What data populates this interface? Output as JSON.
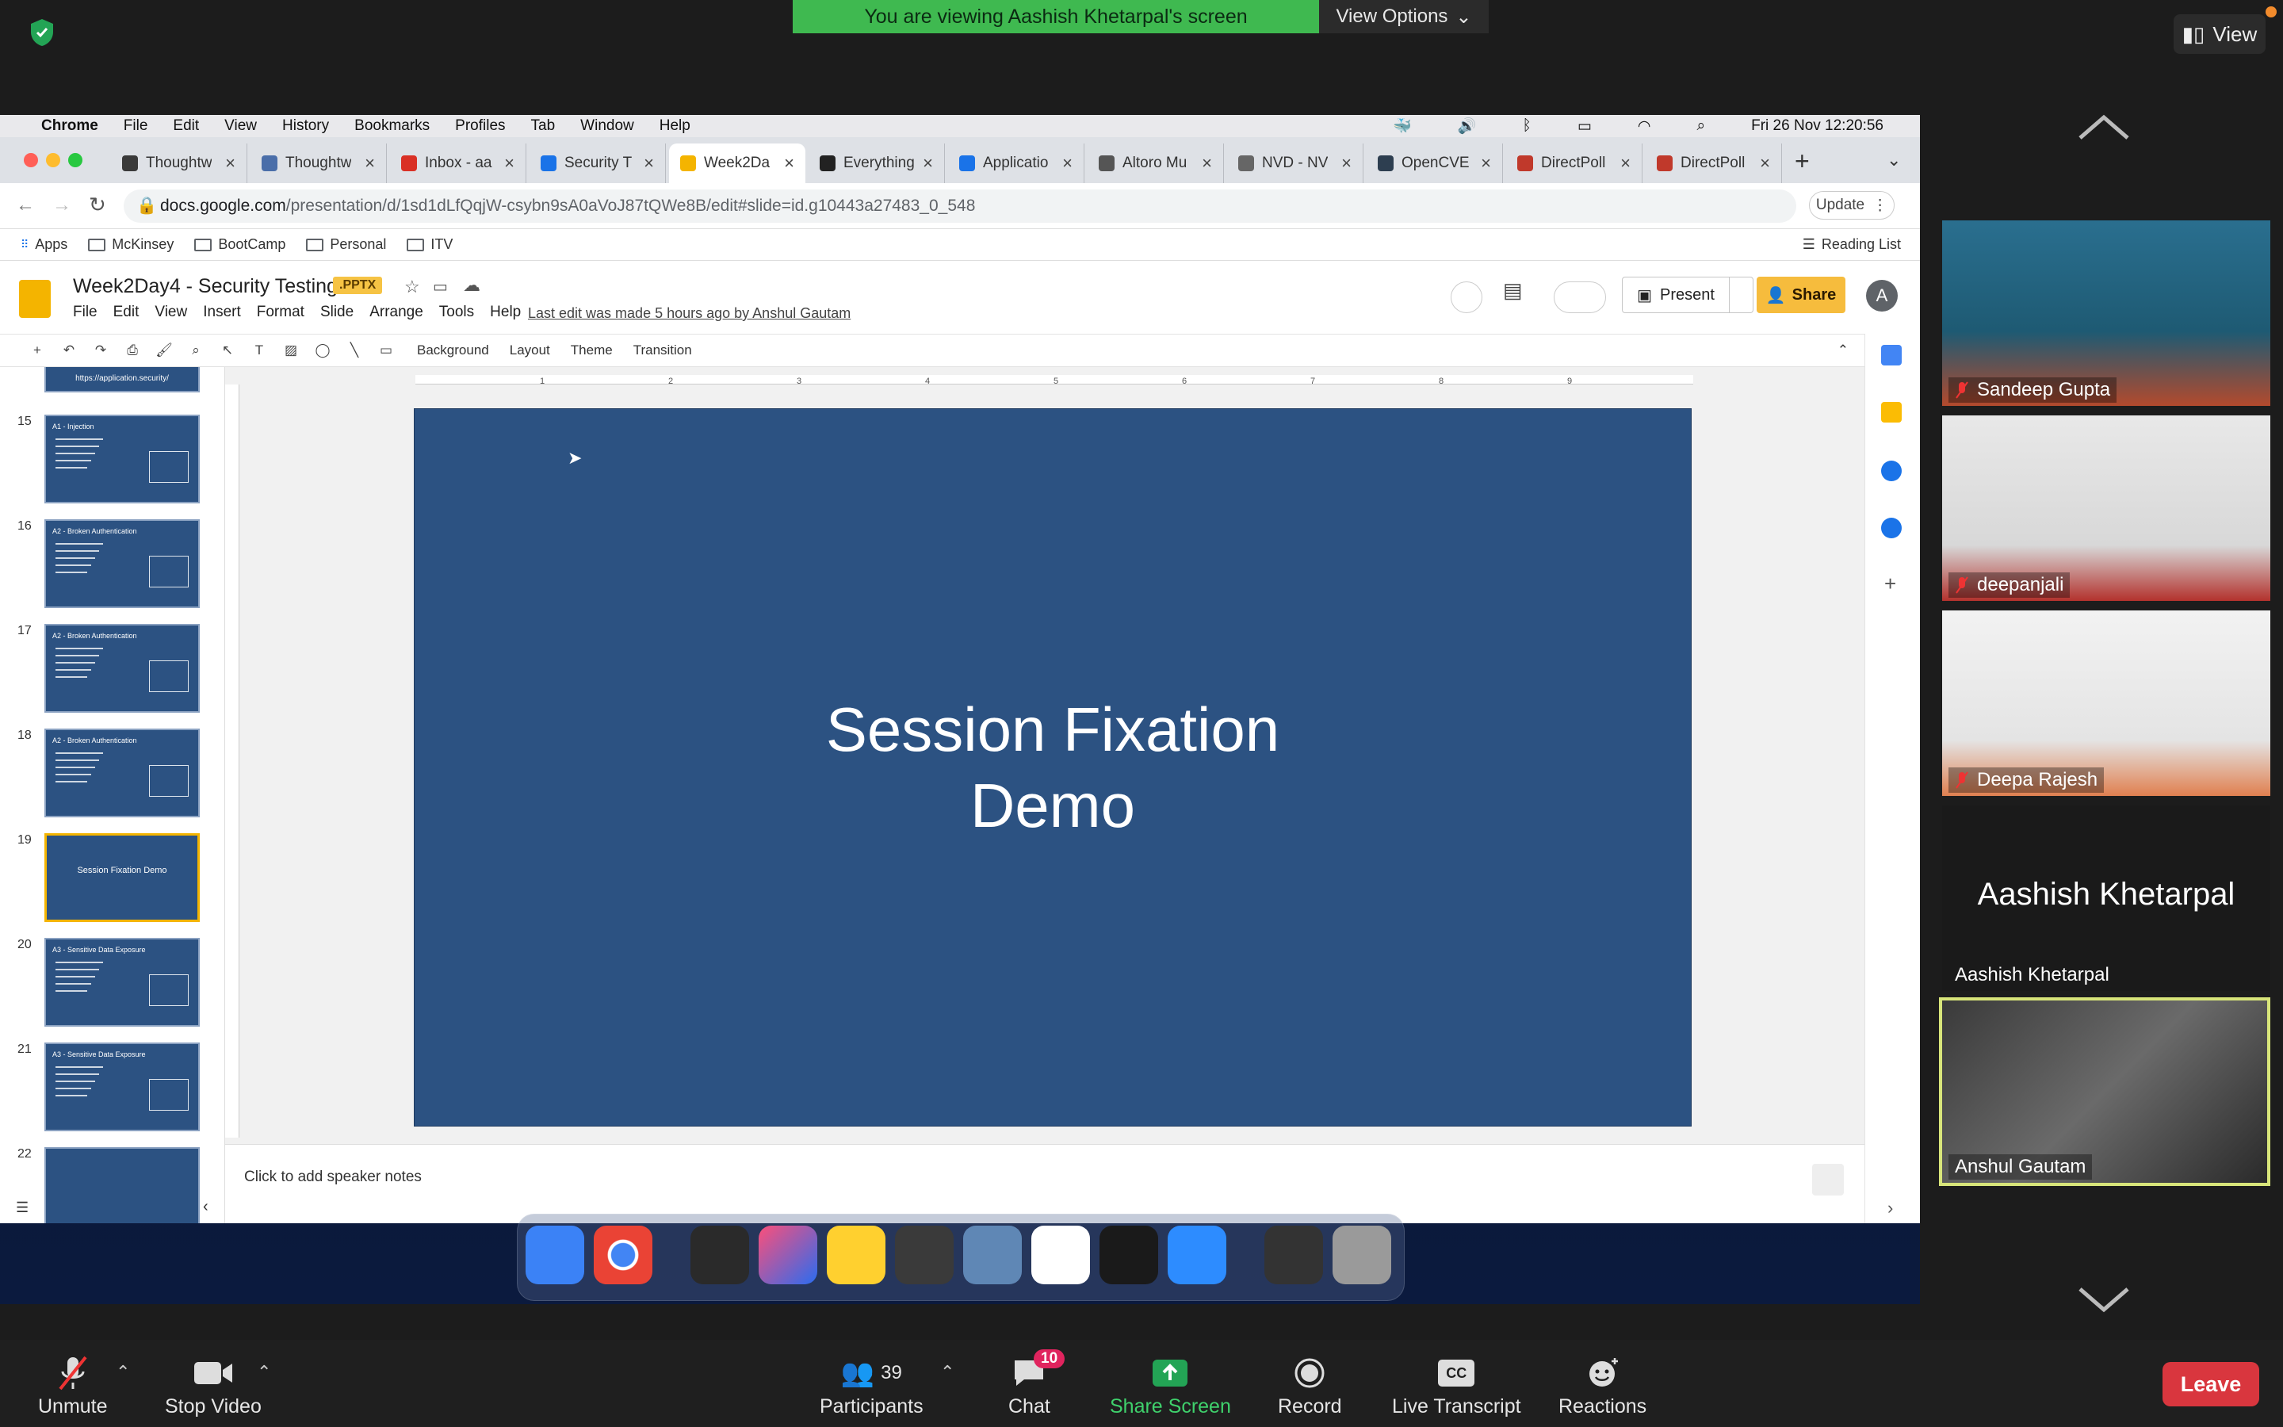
{
  "zoom": {
    "banner": "You are viewing Aashish Khetarpal's screen",
    "view_options": "View Options",
    "top_view": "View",
    "participants": [
      {
        "name": "Sandeep Gupta",
        "muted": true
      },
      {
        "name": "deepanjali",
        "muted": true
      },
      {
        "name": "Deepa Rajesh",
        "muted": true
      },
      {
        "name": "Aashish Khetarpal",
        "muted": false,
        "no_video": true
      },
      {
        "name": "Anshul Gautam",
        "muted": false,
        "speaking": true
      }
    ],
    "toolbar": {
      "unmute": "Unmute",
      "stop_video": "Stop Video",
      "participants": "Participants",
      "participants_count": "39",
      "chat": "Chat",
      "chat_count": "10",
      "share_screen": "Share Screen",
      "record": "Record",
      "live_transcript": "Live Transcript",
      "reactions": "Reactions",
      "leave": "Leave"
    }
  },
  "macos": {
    "menubar": [
      "Chrome",
      "File",
      "Edit",
      "View",
      "History",
      "Bookmarks",
      "Profiles",
      "Tab",
      "Window",
      "Help"
    ],
    "clock": "Fri 26 Nov  12:20:56"
  },
  "chrome": {
    "tabs": [
      {
        "title": "Thoughtw",
        "color": "#3a3a3a"
      },
      {
        "title": "Thoughtw",
        "color": "#4a6ea9"
      },
      {
        "title": "Inbox - aa",
        "color": "#d93025"
      },
      {
        "title": "Security T",
        "color": "#1a73e8"
      },
      {
        "title": "Week2Da",
        "color": "#f4b400",
        "active": true
      },
      {
        "title": "Everything",
        "color": "#222222"
      },
      {
        "title": "Applicatio",
        "color": "#1a73e8"
      },
      {
        "title": "Altoro Mu",
        "color": "#555555"
      },
      {
        "title": "NVD - NV",
        "color": "#666666"
      },
      {
        "title": "OpenCVE",
        "color": "#2d3e50"
      },
      {
        "title": "DirectPoll",
        "color": "#c0392b"
      },
      {
        "title": "DirectPoll",
        "color": "#c0392b"
      }
    ],
    "url_host": "docs.google.com",
    "url_path": "/presentation/d/1sd1dLfQqjW-csybn9sA0aVoJ87tQWe8B/edit#slide=id.g10443a27483_0_548",
    "update_label": "Update",
    "bookmarks": [
      "Apps",
      "McKinsey",
      "BootCamp",
      "Personal",
      "ITV"
    ],
    "reading_list": "Reading List"
  },
  "slides": {
    "doc_title": "Week2Day4 - Security Testing",
    "badge": ".PPTX",
    "menu": [
      "File",
      "Edit",
      "View",
      "Insert",
      "Format",
      "Slide",
      "Arrange",
      "Tools",
      "Help"
    ],
    "last_edit": "Last edit was made 5 hours ago by Anshul Gautam",
    "present": "Present",
    "share": "Share",
    "avatar": "A",
    "toolbar": {
      "background": "Background",
      "layout": "Layout",
      "theme": "Theme",
      "transition": "Transition"
    },
    "ruler_h": [
      "1",
      "2",
      "3",
      "4",
      "5",
      "6",
      "7",
      "8",
      "9"
    ],
    "thumbnails": [
      {
        "num": "15",
        "title": "A1 - Injection"
      },
      {
        "num": "16",
        "title": "A2 - Broken Authentication"
      },
      {
        "num": "17",
        "title": "A2 - Broken Authentication"
      },
      {
        "num": "18",
        "title": "A2 - Broken Authentication"
      },
      {
        "num": "19",
        "title": "Session Fixation Demo",
        "selected": true
      },
      {
        "num": "20",
        "title": "A3 - Sensitive Data Exposure"
      },
      {
        "num": "21",
        "title": "A3 - Sensitive Data Exposure"
      },
      {
        "num": "22",
        "title": ""
      }
    ],
    "partial_top_thumb": "https://application.security/",
    "current_slide_title": "Session Fixation\nDemo",
    "speaker_notes": "Click to add speaker notes"
  }
}
